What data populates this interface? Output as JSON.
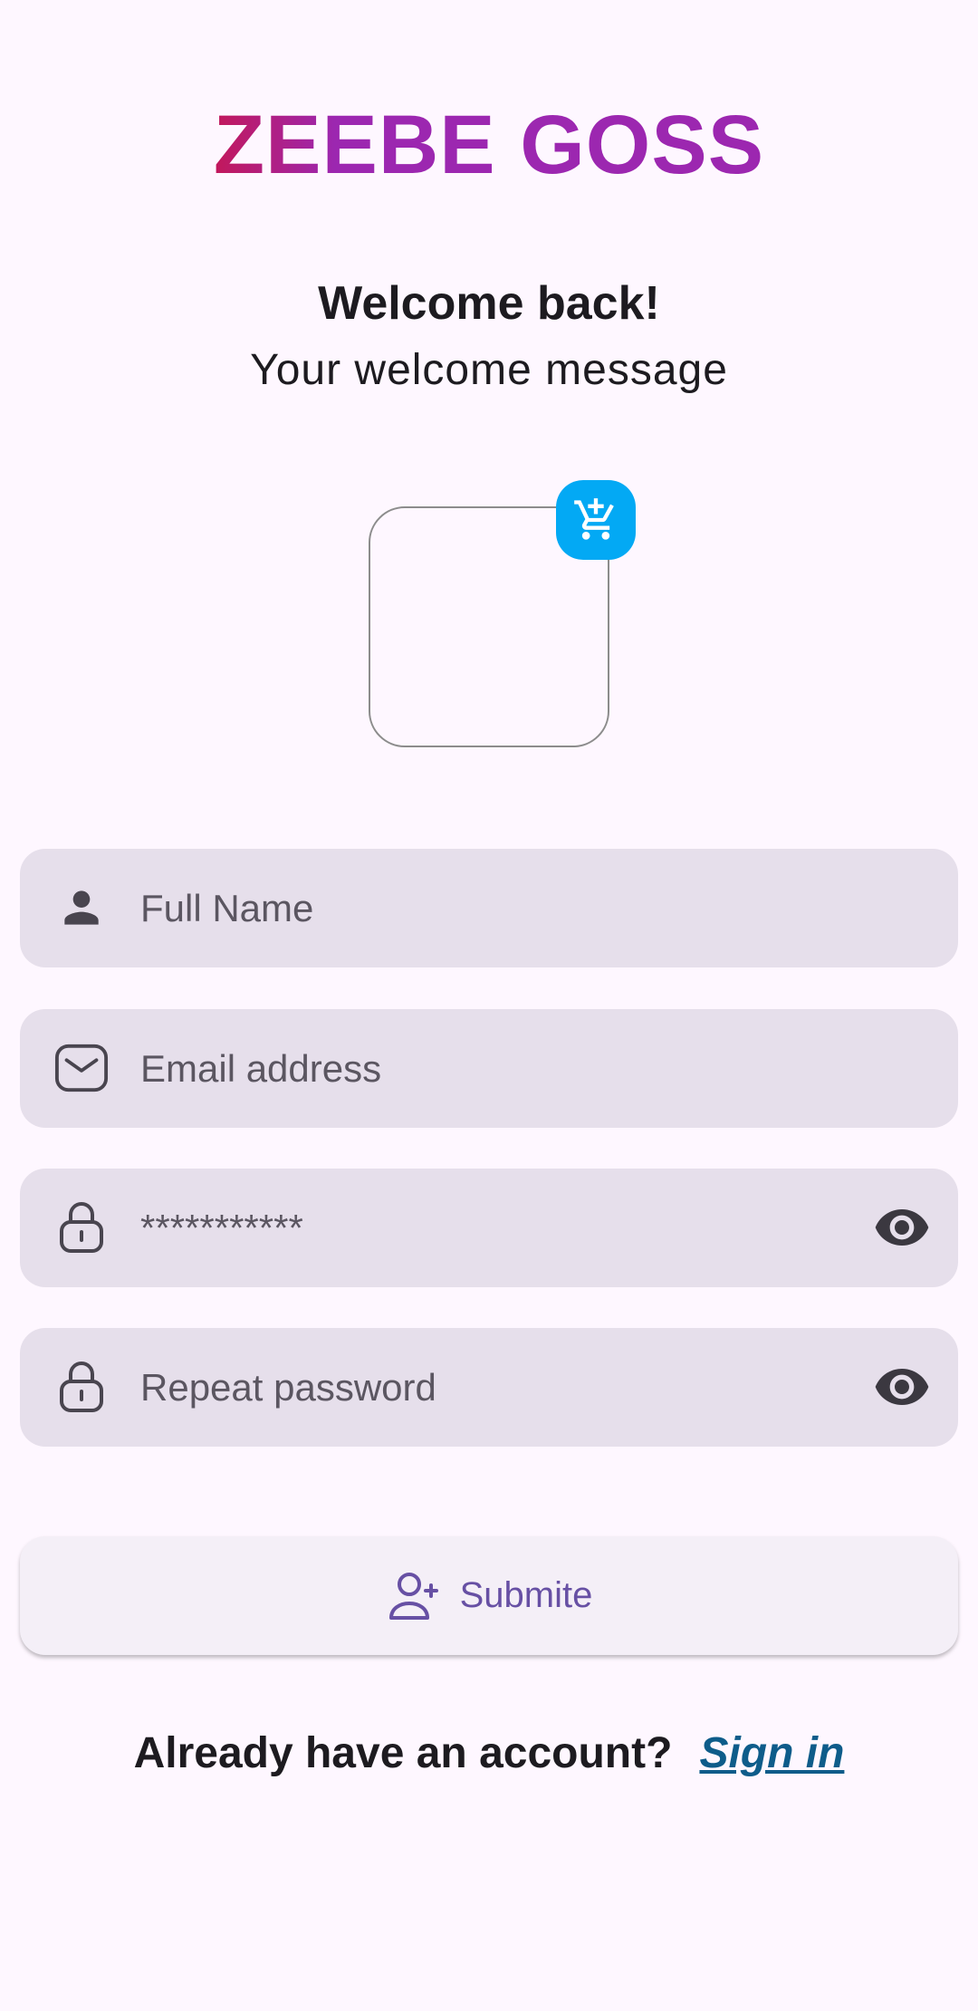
{
  "brand": {
    "title": "ZEEBE GOSS"
  },
  "welcome": {
    "title": "Welcome back!",
    "subtitle": "Your welcome message"
  },
  "image_picker": {
    "badge_icon": "cart-plus-icon"
  },
  "form": {
    "full_name": {
      "placeholder": "Full Name",
      "icon": "person-icon"
    },
    "email": {
      "placeholder": "Email address",
      "icon": "mail-icon"
    },
    "password": {
      "value": "***********",
      "icon": "lock-icon",
      "toggle_icon": "eye-icon"
    },
    "repeat_password": {
      "placeholder": "Repeat password",
      "icon": "lock-icon",
      "toggle_icon": "eye-icon"
    }
  },
  "submit": {
    "label": "Submite",
    "icon": "person-add-icon"
  },
  "footer": {
    "question": "Already have an account?",
    "link": "Sign in"
  },
  "colors": {
    "brand_gradient_start": "#c2185b",
    "brand_gradient_end": "#9c27b0",
    "field_background": "#e6dfeb",
    "badge": "#03a9f4",
    "primary": "#6750a4",
    "link": "#0e5c8a"
  }
}
